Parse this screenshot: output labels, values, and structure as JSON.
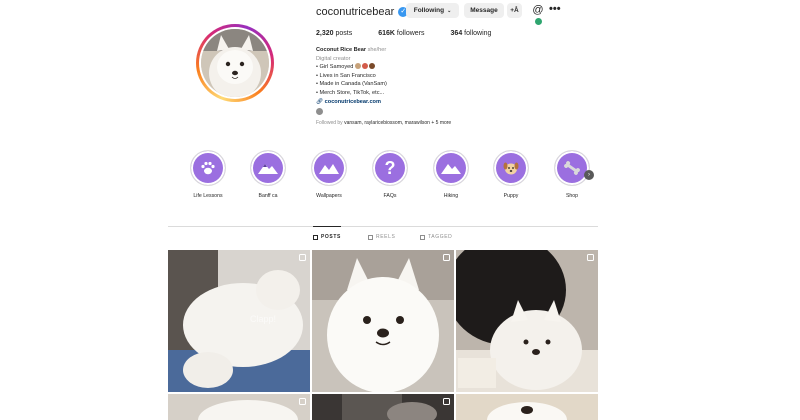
{
  "profile": {
    "username": "coconutricebear",
    "verified": true,
    "buttons": {
      "following": "Following",
      "message": "Message",
      "add_person": "+Å"
    },
    "stats": {
      "posts_count": "2,320",
      "posts_label": "posts",
      "followers_count": "616K",
      "followers_label": "followers",
      "following_count": "364",
      "following_label": "following"
    },
    "bio": {
      "name": "Coconut Rice Bear",
      "pronouns": "she/her",
      "category": "Digital creator",
      "lines": [
        "• Girl Samoyed",
        "• Lives in San Francisco",
        "• Made in Canada (VanSam)",
        "• Merch Store, TikTok, etc..."
      ],
      "link": "coconutricebear.com"
    },
    "followed_by_prefix": "Followed by",
    "followed_by_names": "vansam, raylaricebiossom, marawilson",
    "followed_by_more": "+ 5 more"
  },
  "highlights": [
    {
      "label": "Life Lessons",
      "icon": "paw-icon"
    },
    {
      "label": "Banff ca",
      "icon": "mountain-icon"
    },
    {
      "label": "Wallpapers",
      "icon": "mountain-icon"
    },
    {
      "label": "FAQs",
      "icon": "question-icon"
    },
    {
      "label": "Hiking",
      "icon": "mountain-icon"
    },
    {
      "label": "Puppy",
      "icon": "dog-face-icon"
    },
    {
      "label": "Shop",
      "icon": "bone-icon"
    }
  ],
  "tabs": [
    {
      "label": "POSTS",
      "active": true
    },
    {
      "label": "REELS",
      "active": false
    },
    {
      "label": "TAGGED",
      "active": false
    }
  ],
  "posts": {
    "post_1_caption": "Clapp!"
  },
  "colors": {
    "highlight_bg": "#9b6fe0",
    "verified": "#3897f0",
    "link": "#00376b"
  }
}
